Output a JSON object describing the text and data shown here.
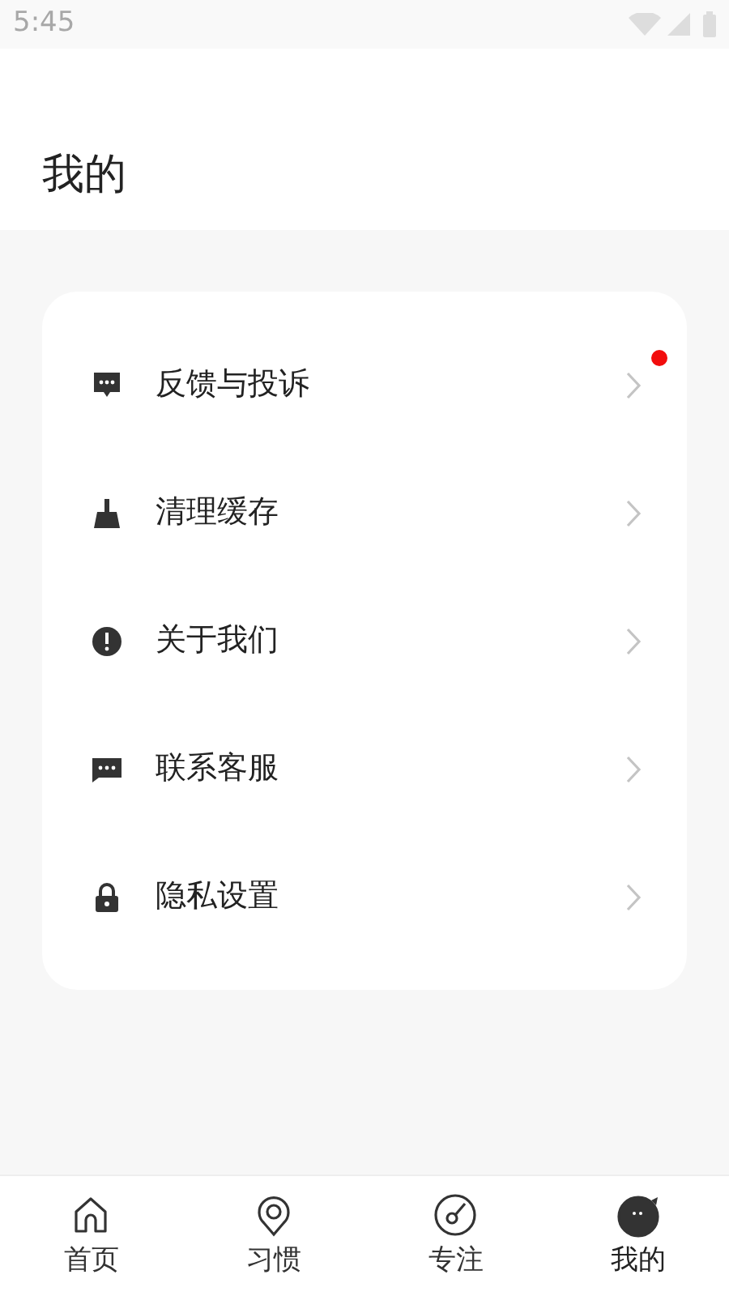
{
  "status_bar": {
    "time": "5:45"
  },
  "header": {
    "title": "我的"
  },
  "menu": [
    {
      "kind": "feedback",
      "label": "反馈与投诉",
      "badge": true
    },
    {
      "kind": "clean",
      "label": "清理缓存",
      "badge": false
    },
    {
      "kind": "about",
      "label": "关于我们",
      "badge": false
    },
    {
      "kind": "service",
      "label": "联系客服",
      "badge": false
    },
    {
      "kind": "privacy",
      "label": "隐私设置",
      "badge": false
    }
  ],
  "tabs": [
    {
      "kind": "home",
      "label": "首页",
      "selected": false
    },
    {
      "kind": "habit",
      "label": "习惯",
      "selected": false
    },
    {
      "kind": "focus",
      "label": "专注",
      "selected": false
    },
    {
      "kind": "me",
      "label": "我的",
      "selected": true
    }
  ]
}
